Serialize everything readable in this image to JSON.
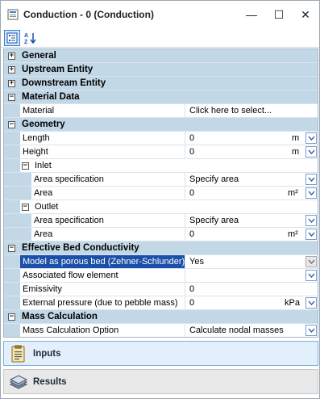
{
  "window": {
    "title": "Conduction - 0 (Conduction)"
  },
  "controls": {
    "minimize": "—",
    "maximize": "☐",
    "close": "✕"
  },
  "categories": {
    "general": "General",
    "upstream": "Upstream Entity",
    "downstream": "Downstream Entity",
    "material": "Material Data",
    "geometry": "Geometry",
    "ebc": "Effective Bed Conductivity",
    "mass": "Mass Calculation"
  },
  "expanders": {
    "collapsed": "+",
    "expanded": "−"
  },
  "material": {
    "label": "Material",
    "value": "Click here to select..."
  },
  "geometry": {
    "length": {
      "label": "Length",
      "value": "0",
      "unit": "m"
    },
    "height": {
      "label": "Height",
      "value": "0",
      "unit": "m"
    },
    "inlet": {
      "label": "Inlet",
      "area_spec": {
        "label": "Area specification",
        "value": "Specify area"
      },
      "area": {
        "label": "Area",
        "value": "0",
        "unit": "m²"
      }
    },
    "outlet": {
      "label": "Outlet",
      "area_spec": {
        "label": "Area specification",
        "value": "Specify area"
      },
      "area": {
        "label": "Area",
        "value": "0",
        "unit": "m²"
      }
    }
  },
  "ebc": {
    "porous": {
      "label": "Model as porous bed (Zehner-Schlunder)",
      "value": "Yes"
    },
    "flow_element": {
      "label": "Associated flow element",
      "value": ""
    },
    "emissivity": {
      "label": "Emissivity",
      "value": "0"
    },
    "ext_pressure": {
      "label": "External pressure (due to pebble mass)",
      "value": "0",
      "unit": "kPa"
    }
  },
  "mass": {
    "option": {
      "label": "Mass Calculation Option",
      "value": "Calculate nodal masses"
    }
  },
  "panels": {
    "inputs": "Inputs",
    "results": "Results"
  },
  "colors": {
    "category_bg": "#c3d8e7",
    "selection": "#1b4fa8",
    "inputs_bg": "#e3f0fc"
  }
}
